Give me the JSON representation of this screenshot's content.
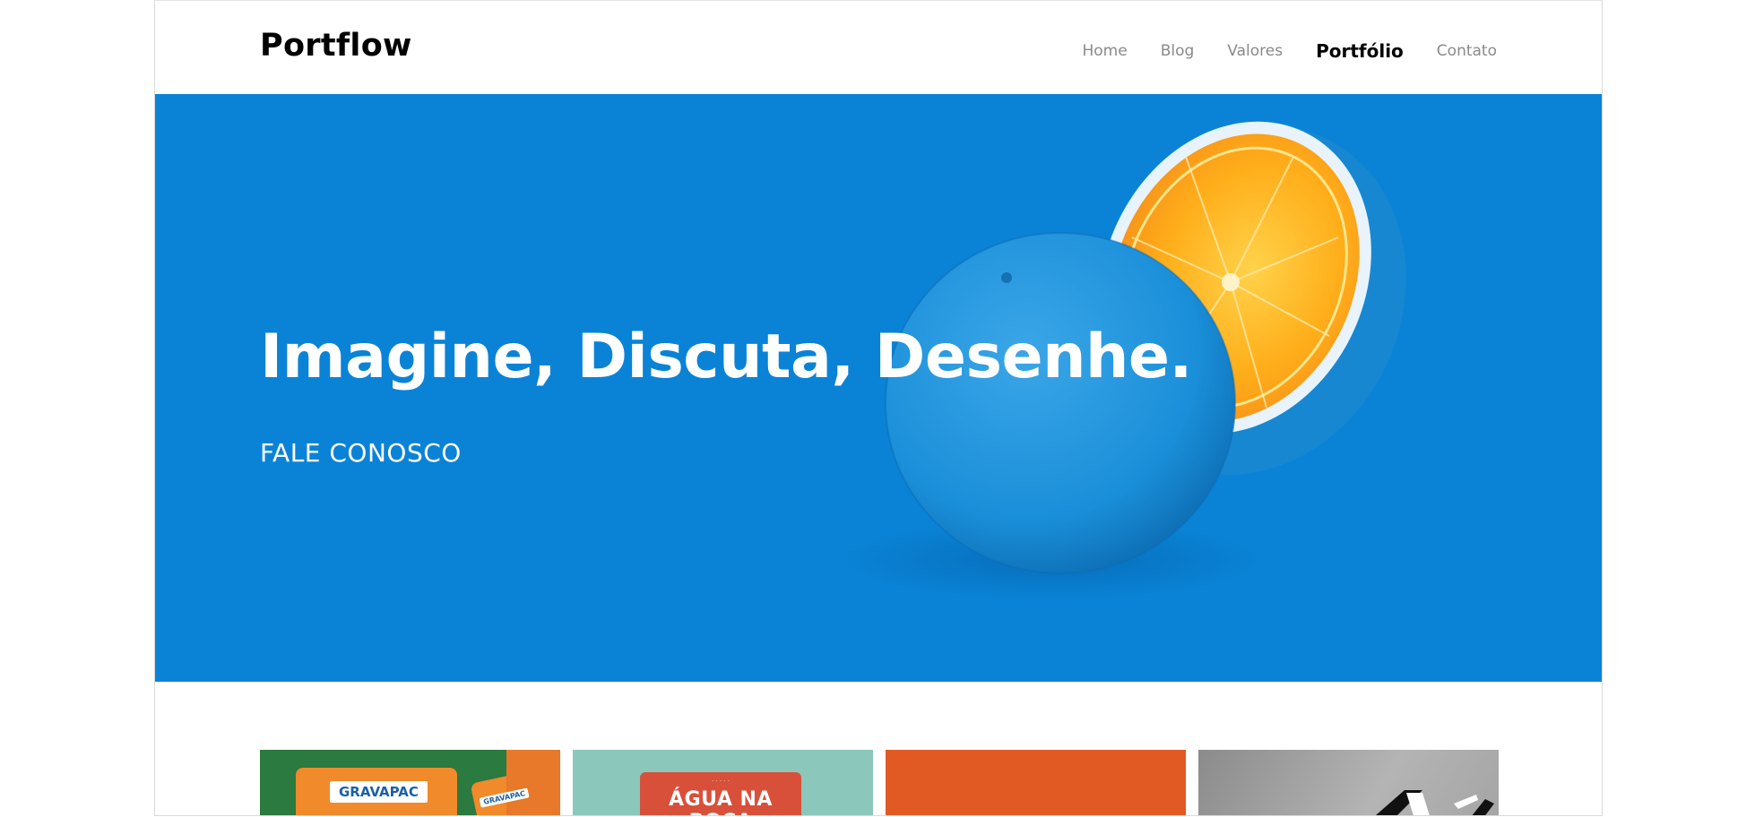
{
  "brand": {
    "name": "Portflow"
  },
  "nav": {
    "items": [
      {
        "label": "Home",
        "active": false
      },
      {
        "label": "Blog",
        "active": false
      },
      {
        "label": "Valores",
        "active": false
      },
      {
        "label": "Portfólio",
        "active": true
      },
      {
        "label": "Contato",
        "active": false
      }
    ]
  },
  "hero": {
    "headline": "Imagine, Discuta, Desenhe.",
    "cta": "FALE CONOSCO",
    "background_color": "#0a83d6",
    "image": "blue-painted-orange"
  },
  "portfolio": {
    "cards": [
      {
        "label": "GRAVAPAC",
        "label_small": "GRAVAPAC",
        "color": "#2b7a3f"
      },
      {
        "label": "ÁGUA NA BOCA",
        "color": "#8bc7bb"
      },
      {
        "label": "",
        "color": "#e15a24"
      },
      {
        "label": "",
        "color": "#9a9a9a"
      }
    ]
  },
  "colors": {
    "accent": "#0a83d6",
    "text": "#000000",
    "nav_muted": "#8a8a8a"
  }
}
